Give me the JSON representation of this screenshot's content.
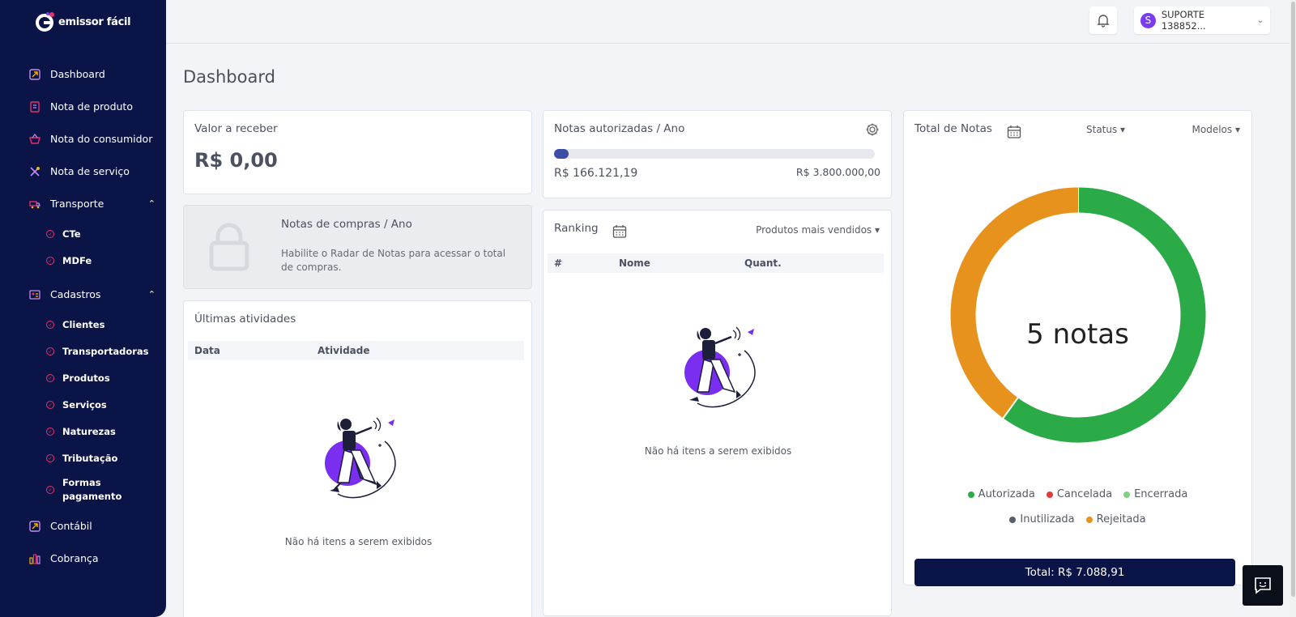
{
  "brand": {
    "name": "emissor fácil",
    "primary": "#0b1447",
    "accent": "#e8306c",
    "purple": "#7a3cf0"
  },
  "sidebar": {
    "items": [
      {
        "label": "Dashboard",
        "icon": "chart-arrow-icon"
      },
      {
        "label": "Nota de produto",
        "icon": "document-icon"
      },
      {
        "label": "Nota do consumidor",
        "icon": "basket-icon"
      },
      {
        "label": "Nota de serviço",
        "icon": "tools-icon"
      },
      {
        "label": "Transporte",
        "icon": "truck-icon",
        "expanded": true
      },
      {
        "label": "Cadastros",
        "icon": "id-card-icon",
        "expanded": true
      },
      {
        "label": "Contábil",
        "icon": "chart-arrow-icon"
      },
      {
        "label": "Cobrança",
        "icon": "bar-chart-icon"
      }
    ],
    "transporte_sub": [
      "CTe",
      "MDFe"
    ],
    "cadastros_sub": [
      "Clientes",
      "Transportadoras",
      "Produtos",
      "Serviços",
      "Naturezas",
      "Tributação",
      "Formas",
      "pagamento"
    ]
  },
  "header": {
    "user_initial": "S",
    "user_name": "SUPORTE 138852..."
  },
  "page": {
    "title": "Dashboard"
  },
  "valor_receber": {
    "title": "Valor a receber",
    "value": "R$ 0,00"
  },
  "compras": {
    "title": "Notas de compras / Ano",
    "text": "Habilite o Radar de Notas para acessar o total de compras."
  },
  "atividades": {
    "title": "Últimas atividades",
    "col_data": "Data",
    "col_atividade": "Atividade",
    "empty": "Não há itens a serem exibidos"
  },
  "autorizadas": {
    "title": "Notas autorizadas / Ano",
    "current": "R$ 166.121,19",
    "limit": "R$ 3.800.000,00",
    "progress_fraction": 0.044
  },
  "ranking": {
    "title": "Ranking",
    "filter": "Produtos mais vendidos ▾",
    "col_num": "#",
    "col_nome": "Nome",
    "col_quant": "Quant.",
    "empty": "Não há itens a serem exibidos"
  },
  "total_notas": {
    "title": "Total de Notas",
    "status_filter": "Status ▾",
    "modelos_filter": "Modelos ▾",
    "center_label": "5 notas",
    "total": "Total: R$ 7.088,91",
    "legend": [
      {
        "label": "Autorizada",
        "color": "#2bab48"
      },
      {
        "label": "Cancelada",
        "color": "#e03c3c"
      },
      {
        "label": "Encerrada",
        "color": "#7fd07f"
      },
      {
        "label": "Inutilizada",
        "color": "#55606f"
      },
      {
        "label": "Rejeitada",
        "color": "#e8921e"
      }
    ]
  },
  "chart_data": {
    "type": "pie",
    "categories": [
      "Autorizada",
      "Rejeitada"
    ],
    "values": [
      3,
      2
    ],
    "colors": [
      "#2bab48",
      "#e8921e"
    ]
  }
}
